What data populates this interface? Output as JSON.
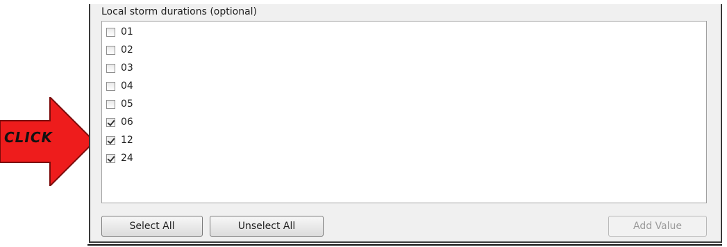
{
  "group": {
    "title": "Local storm durations (optional)"
  },
  "durations": [
    {
      "label": "01",
      "checked": false
    },
    {
      "label": "02",
      "checked": false
    },
    {
      "label": "03",
      "checked": false
    },
    {
      "label": "04",
      "checked": false
    },
    {
      "label": "05",
      "checked": false
    },
    {
      "label": "06",
      "checked": true
    },
    {
      "label": "12",
      "checked": true
    },
    {
      "label": "24",
      "checked": true
    }
  ],
  "buttons": {
    "select_all": "Select All",
    "unselect_all": "Unselect All",
    "add_value": "Add Value"
  },
  "annotation": {
    "label": "CLICK",
    "color": "#ee1c1c"
  }
}
